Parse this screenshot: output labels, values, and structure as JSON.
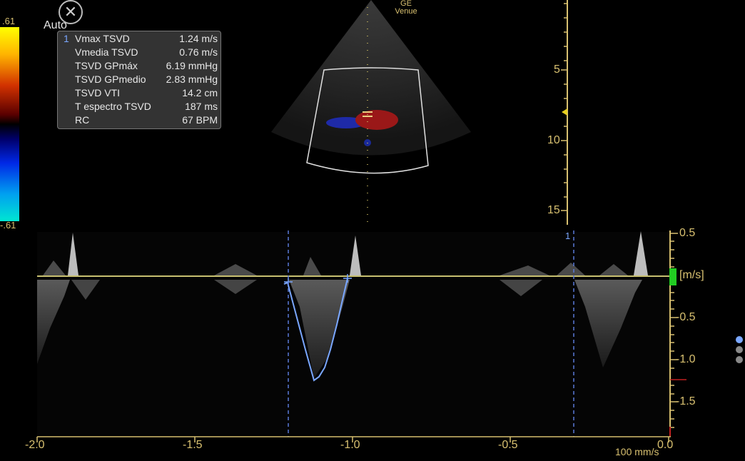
{
  "colorbar": {
    "top": ".61",
    "bottom": "-.61"
  },
  "header": {
    "auto_label": "Auto",
    "close_glyph": "✕"
  },
  "probe": {
    "line1": "GE",
    "line2": "Venue"
  },
  "measurements": [
    {
      "index": "1",
      "name": "Vmax TSVD",
      "value": "1.24 m/s"
    },
    {
      "index": "",
      "name": "Vmedia TSVD",
      "value": "0.76 m/s"
    },
    {
      "index": "",
      "name": "TSVD GPmáx",
      "value": "6.19 mmHg"
    },
    {
      "index": "",
      "name": "TSVD GPmedio",
      "value": "2.83 mmHg"
    },
    {
      "index": "",
      "name": "TSVD VTI",
      "value": "14.2 cm"
    },
    {
      "index": "",
      "name": "T espectro TSVD",
      "value": "187 ms"
    },
    {
      "index": "",
      "name": "RC",
      "value": "67 BPM"
    }
  ],
  "depth_scale": {
    "ticks": [
      "5",
      "10",
      "15"
    ]
  },
  "doppler": {
    "velocity_ticks": [
      "0.5",
      "-0.5",
      "-1.0",
      "-1.5"
    ],
    "unit": "[m/s]",
    "time_ticks": [
      "-2.0",
      "-1.5",
      "-1.0",
      "-0.5",
      "0.0"
    ],
    "sweep_speed": "100 mm/s",
    "cursor_label": "1"
  },
  "colors": {
    "accent": "#d8c070",
    "trace": "#7aa7ff",
    "baseline": "#c8c070",
    "marker": "#22cc22"
  },
  "page_dots": [
    {
      "color": "#7aa7ff",
      "state": "active"
    },
    {
      "color": "#888888",
      "state": "inactive"
    },
    {
      "color": "#888888",
      "state": "inactive"
    }
  ]
}
